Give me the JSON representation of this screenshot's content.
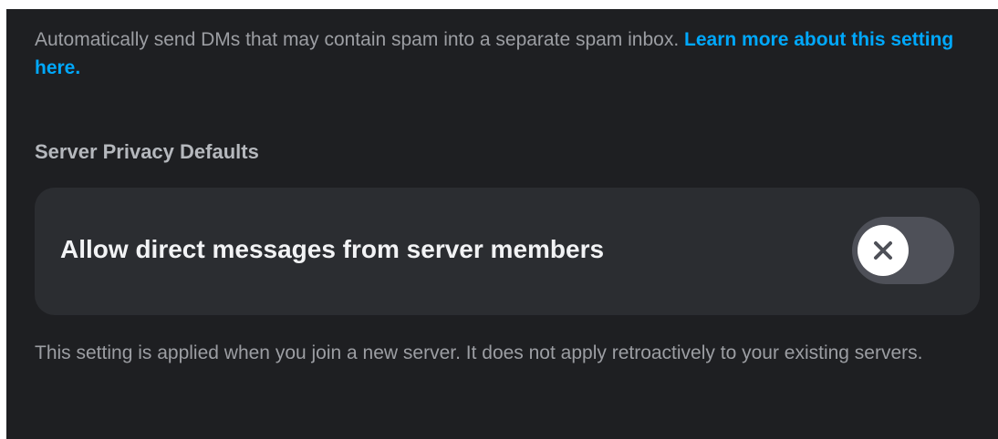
{
  "dm_spam": {
    "description": "Automatically send DMs that may contain spam into a separate spam inbox.",
    "link_text": "Learn more about this setting here."
  },
  "server_privacy": {
    "section_title": "Server Privacy Defaults",
    "setting_label": "Allow direct messages from server members",
    "toggle_state": "off",
    "toggle_icon": "close-icon",
    "footnote": "This setting is applied when you join a new server. It does not apply retroactively to your existing servers."
  },
  "colors": {
    "background": "#1e1f22",
    "card": "#2b2d31",
    "link": "#00a8fc",
    "toggle_off": "#4e5058",
    "knob": "#ffffff"
  }
}
